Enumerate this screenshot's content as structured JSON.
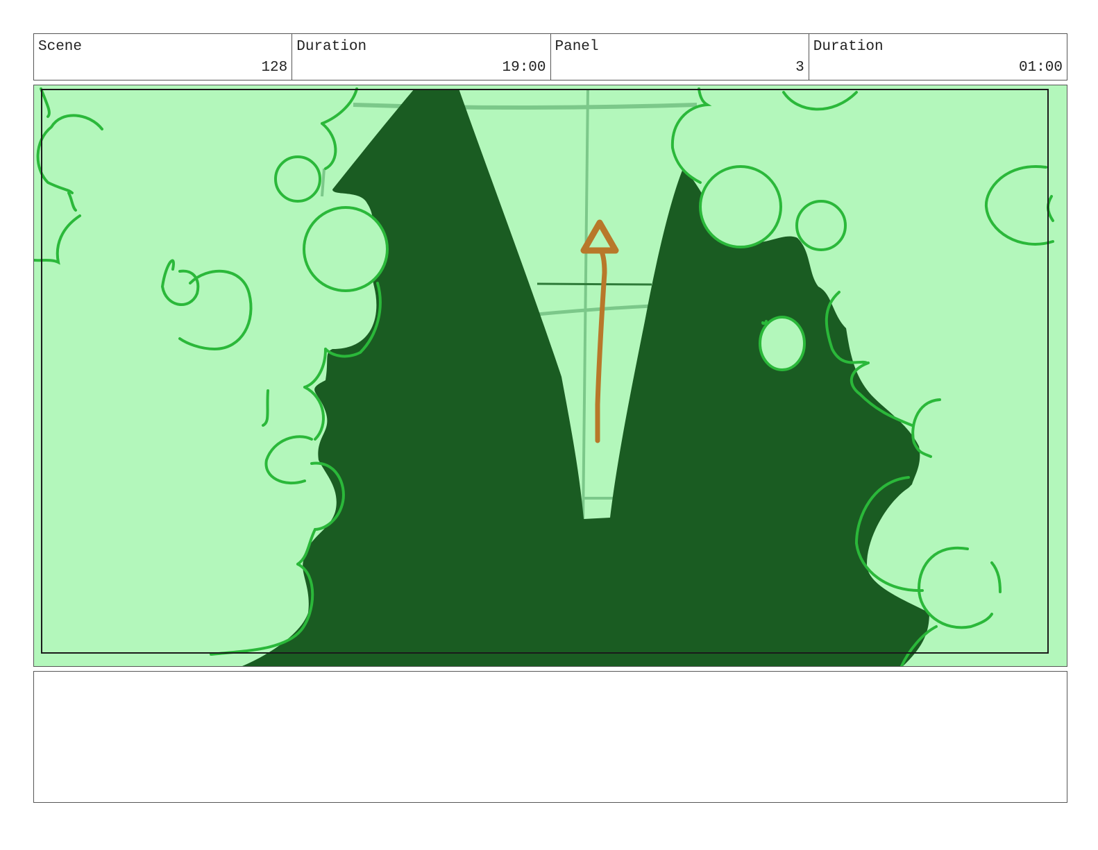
{
  "header": {
    "scene_label": "Scene",
    "scene_value": "128",
    "scene_duration_label": "Duration",
    "scene_duration_value": "19:00",
    "panel_label": "Panel",
    "panel_value": "3",
    "panel_duration_label": "Duration",
    "panel_duration_value": "01:00"
  },
  "panel_artwork": {
    "icon": "foliage-path-sketch-icon",
    "colors": {
      "light_foliage": "#b3f7bb",
      "dark_foliage": "#1a5c22",
      "outline": "#2bb83a",
      "arrow": "#b8782a",
      "guide_lines": "#7cc88a"
    }
  },
  "notes": {}
}
